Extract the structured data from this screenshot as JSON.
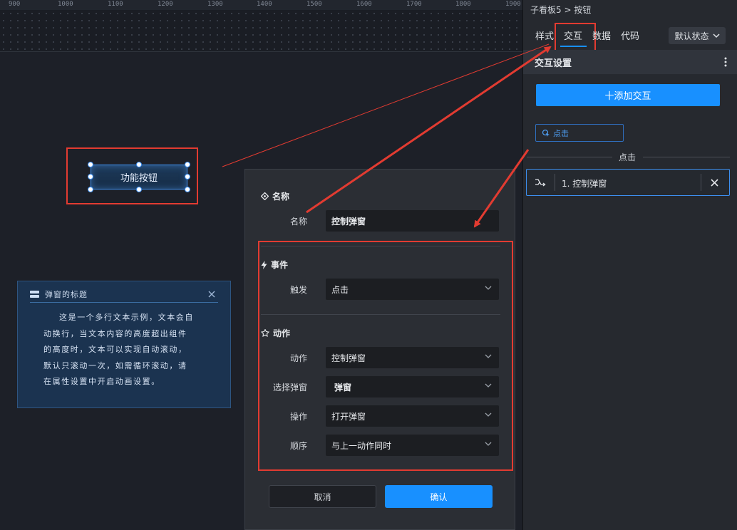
{
  "ruler": {
    "ticks": [
      "900",
      "1000",
      "1100",
      "1200",
      "1300",
      "1400",
      "1500",
      "1600",
      "1700",
      "1800",
      "1900"
    ]
  },
  "canvas": {
    "selected_button_label": "功能按钮",
    "popup": {
      "title": "弹窗的标题",
      "body": "这是一个多行文本示例，文本会自动换行，当文本内容的高度超出组件的高度时，文本可以实现自动滚动，默认只滚动一次，如需循环滚动，请在属性设置中开启动画设置。"
    }
  },
  "panel": {
    "breadcrumb_parent": "子看板5",
    "breadcrumb_sep": ">",
    "breadcrumb_current": "按钮",
    "tabs": [
      "样式",
      "交互",
      "数据",
      "代码"
    ],
    "active_tab": "交互",
    "state_dropdown": "默认状态",
    "section_title": "交互设置",
    "add_button": "十添加交互",
    "event_chip": "点击",
    "divider_label": "点击",
    "interaction_item": "1. 控制弹窗"
  },
  "dialog": {
    "name_section": "名称",
    "name_label": "名称",
    "name_value": "控制弹窗",
    "event_section": "事件",
    "trigger_label": "触发",
    "trigger_value": "点击",
    "action_section": "动作",
    "action_label": "动作",
    "action_value": "控制弹窗",
    "select_popup_label": "选择弹窗",
    "select_popup_value": "弹窗",
    "operation_label": "操作",
    "operation_value": "打开弹窗",
    "order_label": "顺序",
    "order_value": "与上一动作同时",
    "cancel": "取消",
    "confirm": "确认"
  },
  "colors": {
    "accent": "#1890ff",
    "annotation": "#e23b31",
    "panel_bg": "#26292f",
    "dialog_bg": "#2b2e34"
  }
}
